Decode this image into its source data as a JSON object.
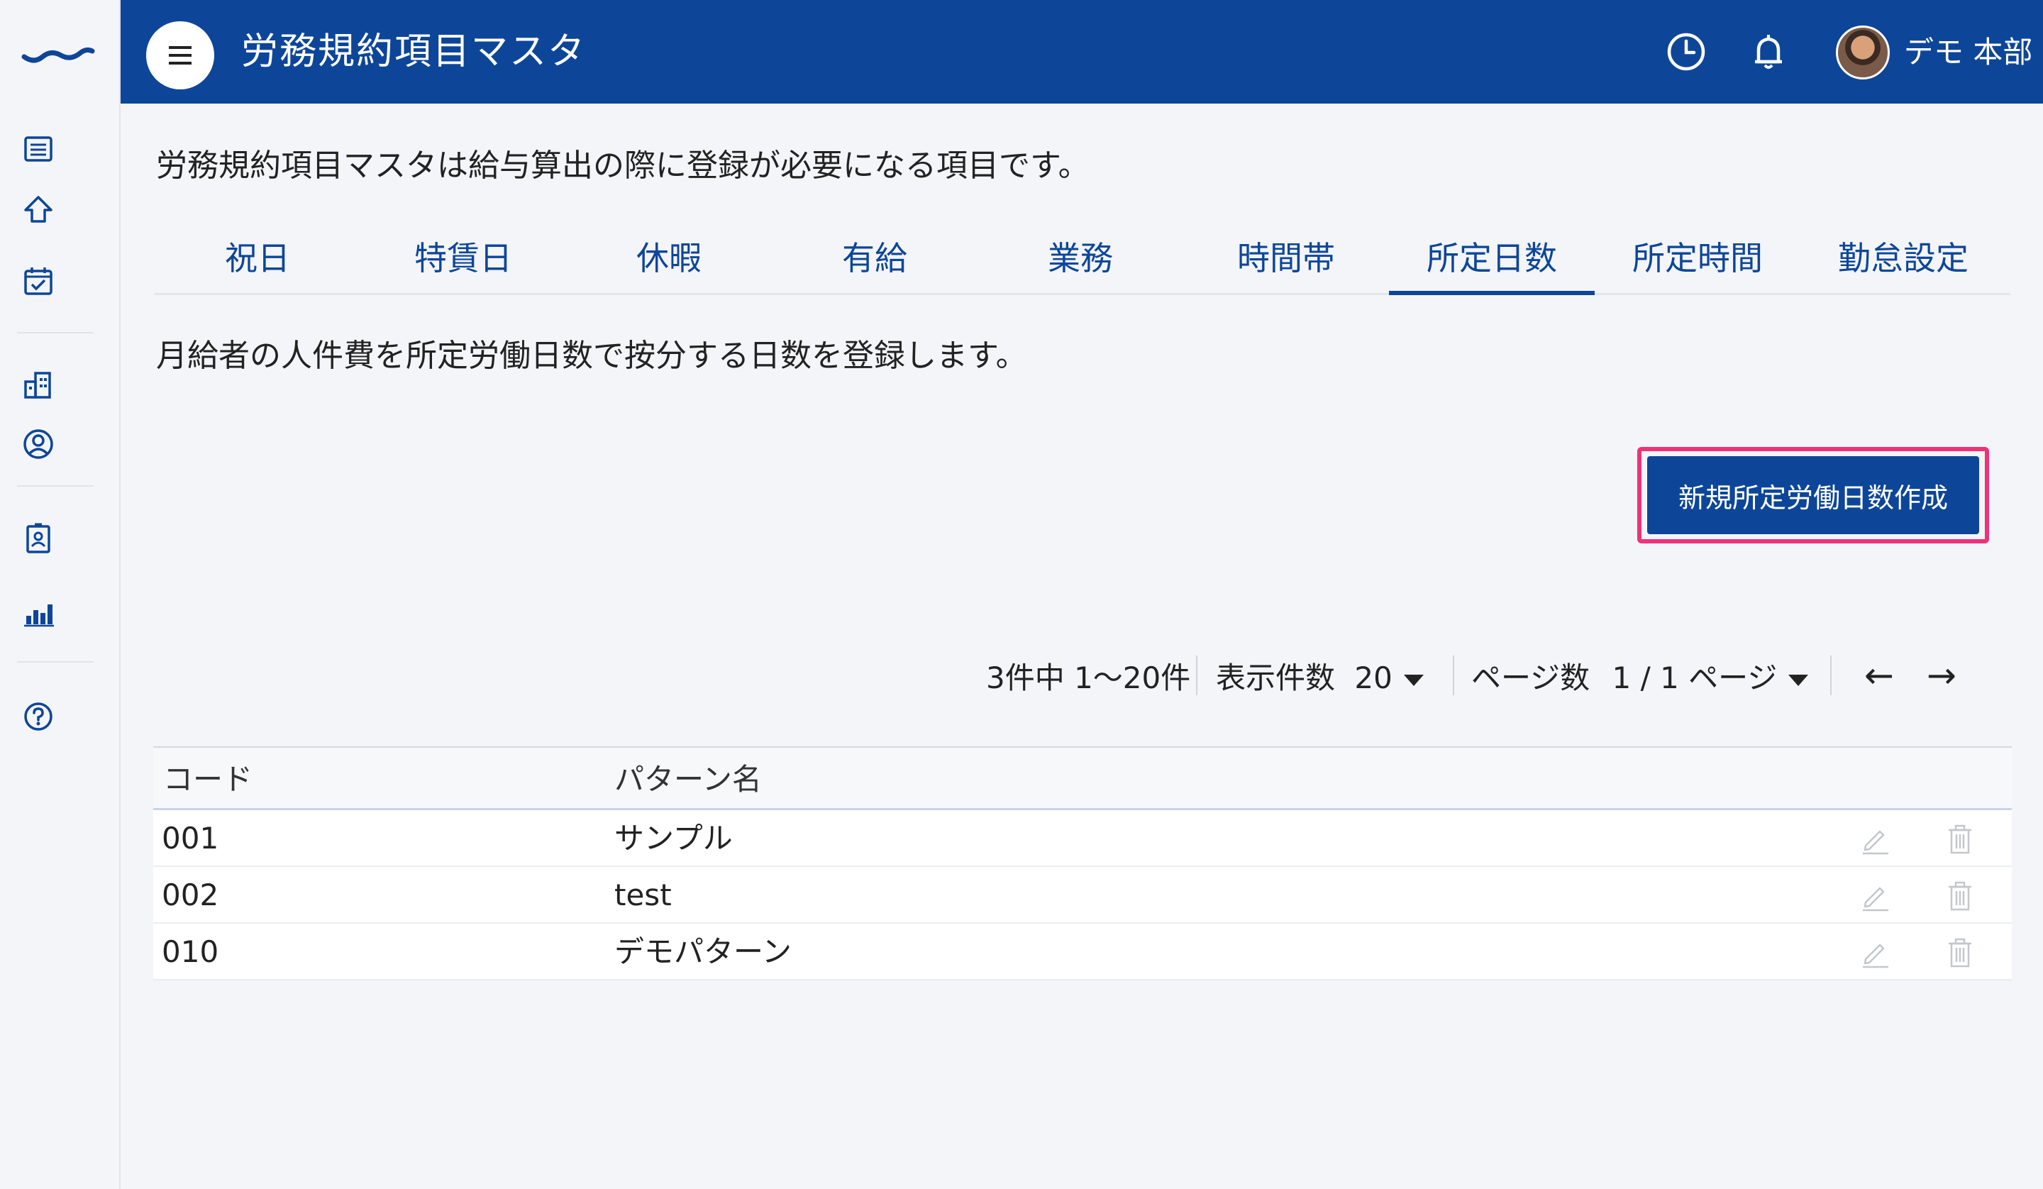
{
  "header": {
    "title": "労務規約項目マスタ",
    "user_name": "デモ 本部",
    "icons": [
      "menu-icon",
      "clock-icon",
      "bell-icon"
    ]
  },
  "sidebar": {
    "icons": [
      "logo",
      "list-icon",
      "home-icon",
      "calendar-check-icon",
      "building-icon",
      "user-circle-icon",
      "id-card-icon",
      "chart-icon",
      "help-icon"
    ]
  },
  "main": {
    "description": "労務規約項目マスタは給与算出の際に登録が必要になる項目です。",
    "tabs": [
      {
        "label": "祝日"
      },
      {
        "label": "特賃日"
      },
      {
        "label": "休暇"
      },
      {
        "label": "有給"
      },
      {
        "label": "業務"
      },
      {
        "label": "時間帯"
      },
      {
        "label": "所定日数",
        "active": true
      },
      {
        "label": "所定時間"
      },
      {
        "label": "勤怠設定"
      }
    ],
    "tab_description": "月給者の人件費を所定労働日数で按分する日数を登録します。",
    "create_button": "新規所定労働日数作成"
  },
  "pager": {
    "summary": "3件中 1〜20件",
    "per_page_label": "表示件数",
    "per_page_value": "20",
    "page_label": "ページ数",
    "page_value": "1 / 1 ページ",
    "prev": "←",
    "next": "→"
  },
  "table": {
    "headers": [
      "コード",
      "パターン名"
    ],
    "rows": [
      {
        "code": "001",
        "name": "サンプル"
      },
      {
        "code": "002",
        "name": "test"
      },
      {
        "code": "010",
        "name": "デモパターン"
      }
    ]
  },
  "colors": {
    "primary": "#0d4699",
    "highlight": "#f0317a",
    "background": "#f4f5f8"
  }
}
